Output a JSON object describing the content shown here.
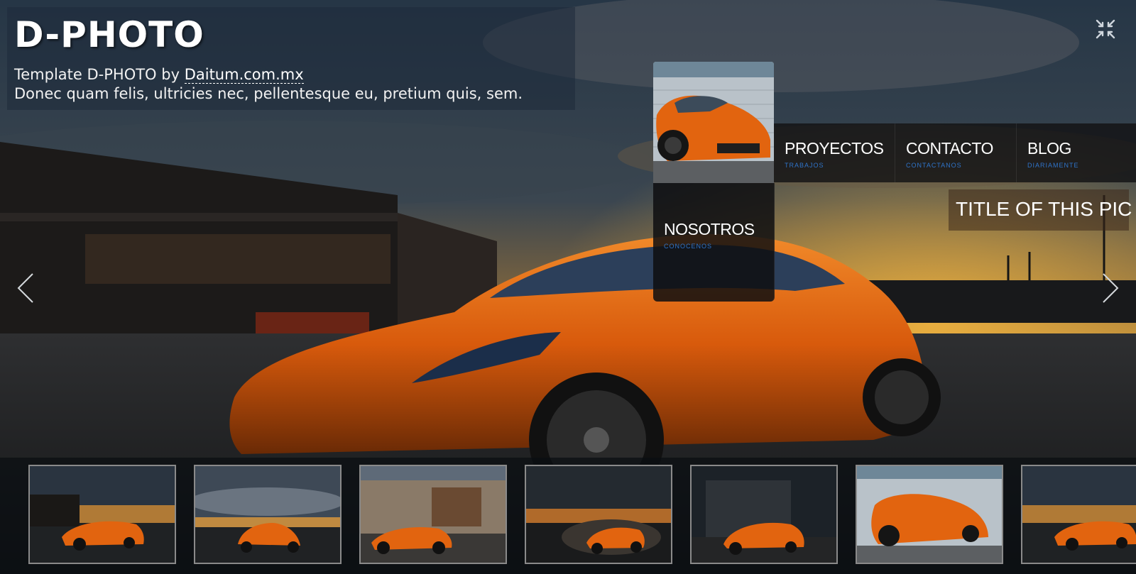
{
  "header": {
    "title": "D-PHOTO",
    "tagline_prefix": "Template D-PHOTO by ",
    "tagline_link": "Daitum.com.mx",
    "description": "Donec quam felis, ultricies nec, pellentesque eu, pretium quis, sem."
  },
  "menu": {
    "items": [
      {
        "label": "PROYECTOS",
        "sub": "TRABAJOS"
      },
      {
        "label": "CONTACTO",
        "sub": "CONTACTANOS"
      },
      {
        "label": "BLOG",
        "sub": "DIARIAMENTE"
      },
      {
        "label": "NOSOTROS",
        "sub": "CONOCENOS"
      }
    ]
  },
  "photo": {
    "title": "TITLE OF THIS PIC"
  },
  "icons": {
    "fullscreen": "fullscreen-toggle-icon",
    "prev": "chevron-left-icon",
    "next": "chevron-right-icon"
  },
  "thumbnails": {
    "count": 7,
    "selected": 1
  },
  "colors": {
    "accent_blue": "#2f74c9",
    "car_orange": "#e2640f",
    "thumb_border": "#8a8a8a"
  }
}
